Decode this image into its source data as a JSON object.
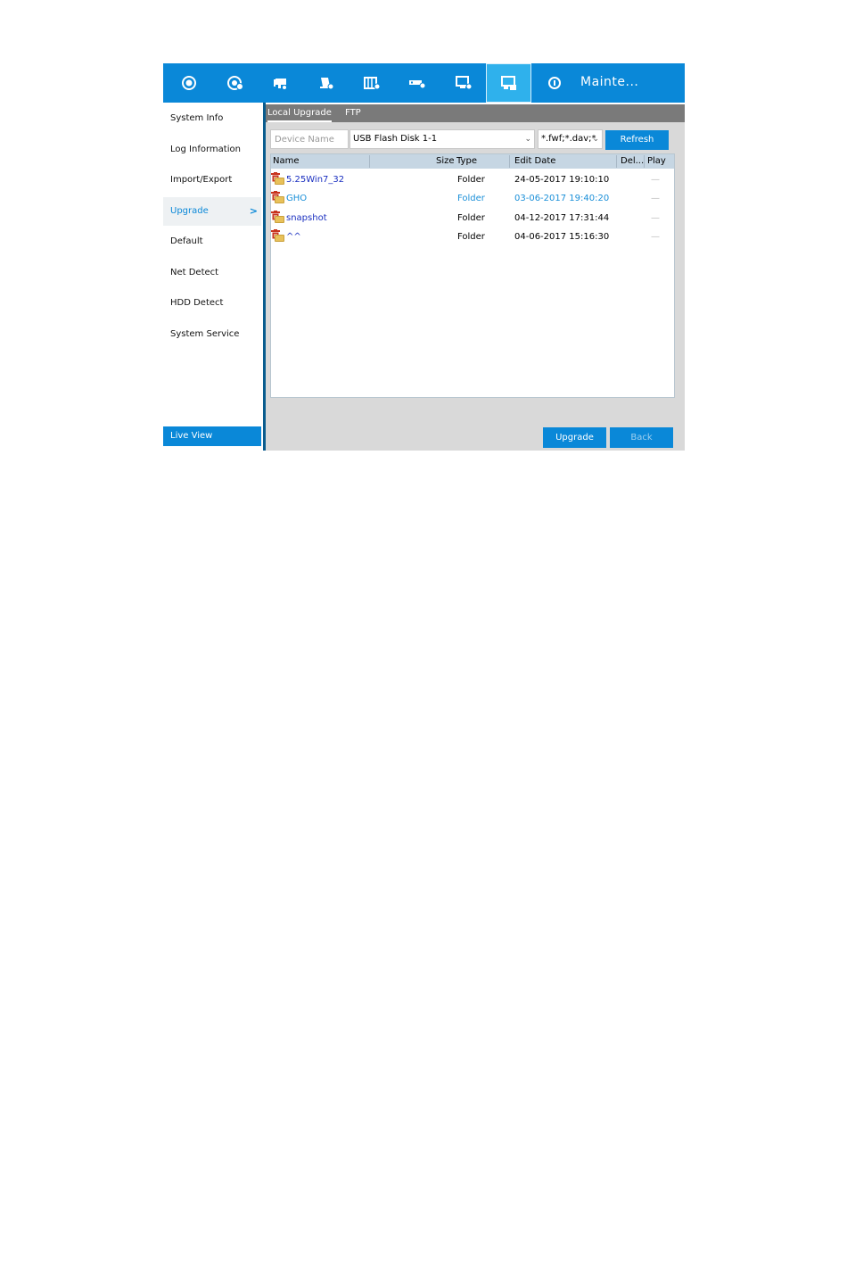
{
  "topbar": {
    "icons": [
      "playback-icon",
      "camera-settings-icon",
      "camera-icon",
      "record-icon",
      "event-icon",
      "network-icon",
      "system-monitor-icon",
      "maintenance-icon",
      "info-icon"
    ],
    "title": "Mainte...",
    "active_index": 7
  },
  "sidebar": {
    "items": [
      {
        "label": "System Info"
      },
      {
        "label": "Log Information"
      },
      {
        "label": "Import/Export"
      },
      {
        "label": "Upgrade",
        "selected": true,
        "chevron": ">"
      },
      {
        "label": "Default"
      },
      {
        "label": "Net Detect"
      },
      {
        "label": "HDD Detect"
      },
      {
        "label": "System Service"
      }
    ],
    "live_view": "Live View"
  },
  "tabs": [
    {
      "label": "Local Upgrade",
      "active": true
    },
    {
      "label": "FTP"
    }
  ],
  "device": {
    "label": "Device Name",
    "value": "USB Flash Disk 1-1",
    "filter": "*.fwf;*.dav;*",
    "refresh": "Refresh"
  },
  "list": {
    "headers": {
      "name": "Name",
      "size": "Size",
      "type": "Type",
      "edit_date": "Edit Date",
      "delete": "Del...",
      "play": "Play"
    },
    "rows": [
      {
        "name": "5.25Win7_32",
        "type": "Folder",
        "date": "24-05-2017 19:10:10",
        "play": "—"
      },
      {
        "name": "GHO",
        "type": "Folder",
        "date": "03-06-2017 19:40:20",
        "play": "—",
        "highlighted": true
      },
      {
        "name": "snapshot",
        "type": "Folder",
        "date": "04-12-2017 17:31:44",
        "play": "—"
      },
      {
        "name": "^^",
        "type": "Folder",
        "date": "04-06-2017 15:16:30",
        "play": "—"
      }
    ]
  },
  "buttons": {
    "upgrade": "Upgrade",
    "back": "Back"
  },
  "colors": {
    "accent": "#0a88d8",
    "active_tile": "#2fb1ec",
    "highlight_text": "#1a8fd8",
    "link_text": "#1a2fc0",
    "delete_icon": "#c8341e"
  }
}
